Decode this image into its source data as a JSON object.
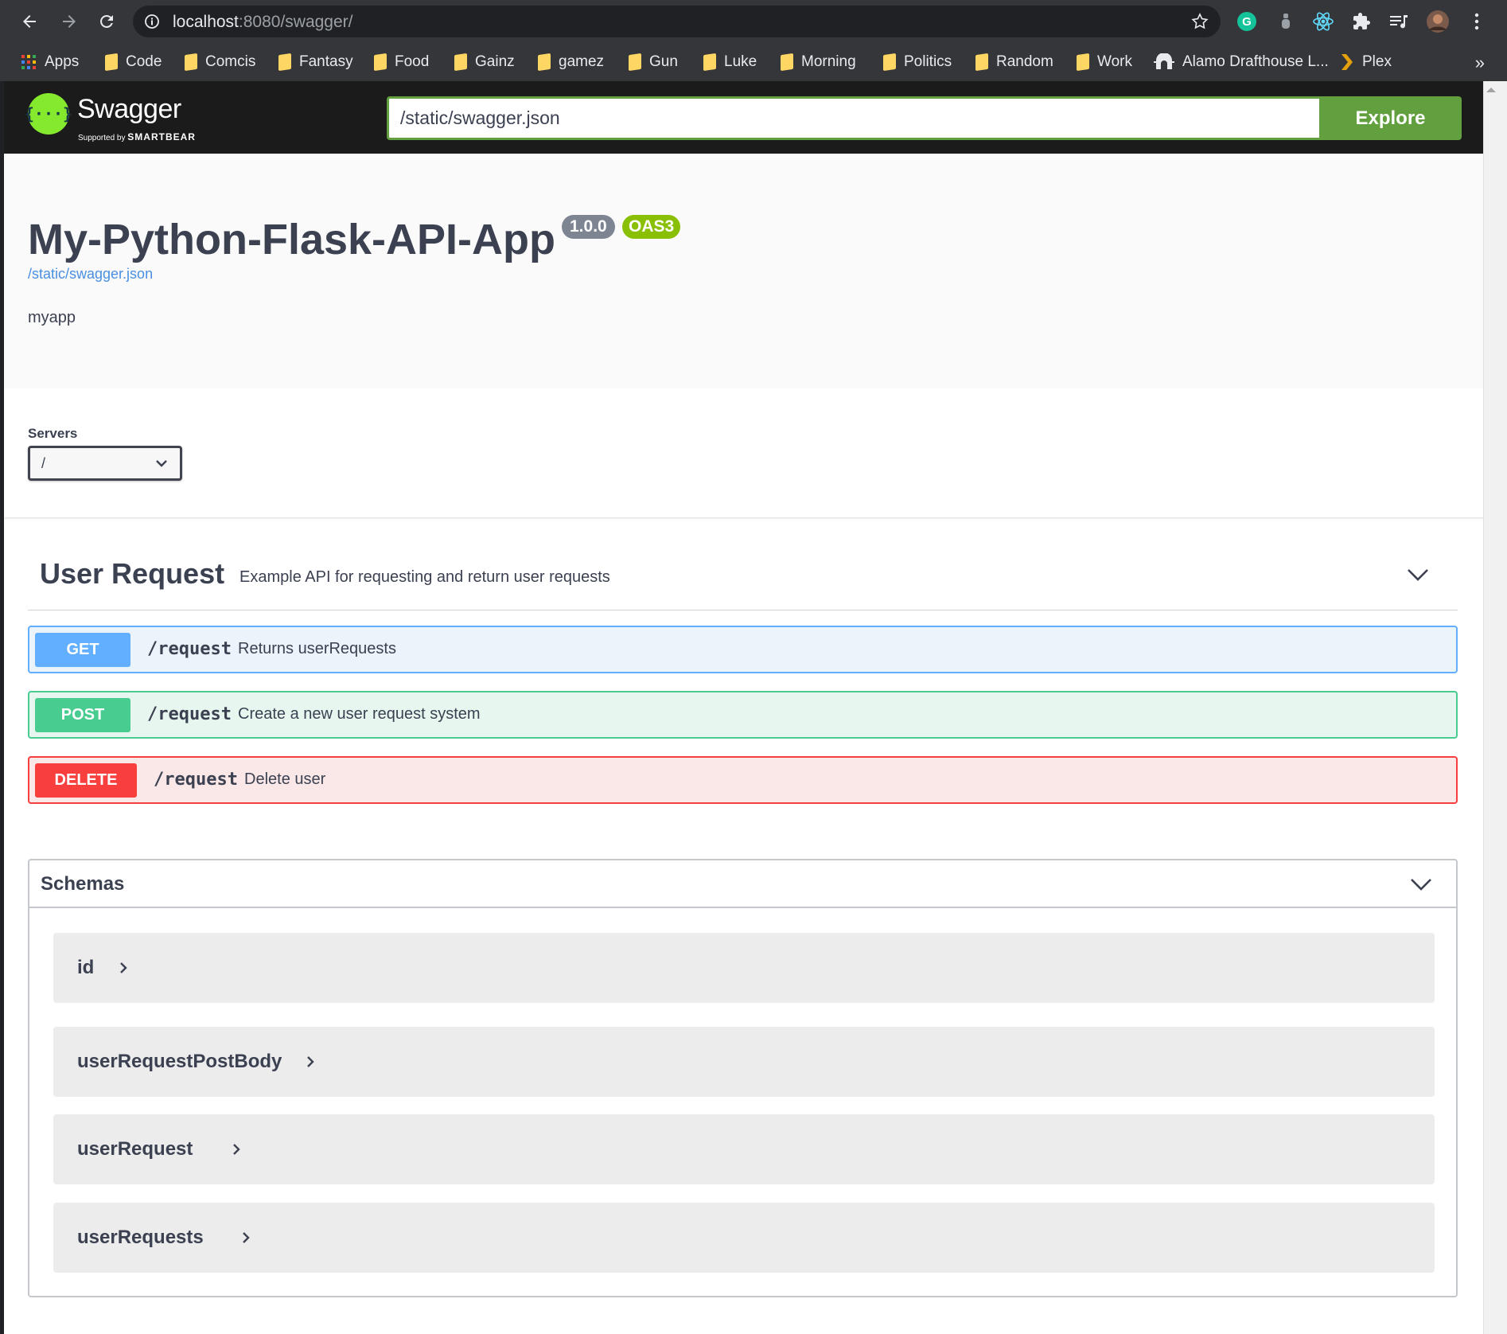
{
  "browser": {
    "url_host": "localhost",
    "url_rest": ":8080/swagger/",
    "bookmarks": [
      {
        "label": "Apps",
        "icon": "apps-grid-icon"
      },
      {
        "label": "Code",
        "icon": "folder-icon"
      },
      {
        "label": "Comcis",
        "icon": "folder-icon"
      },
      {
        "label": "Fantasy",
        "icon": "folder-icon"
      },
      {
        "label": "Food",
        "icon": "folder-icon"
      },
      {
        "label": "Gainz",
        "icon": "folder-icon"
      },
      {
        "label": "gamez",
        "icon": "folder-icon"
      },
      {
        "label": "Gun",
        "icon": "folder-icon"
      },
      {
        "label": "Luke",
        "icon": "folder-icon"
      },
      {
        "label": "Morning",
        "icon": "folder-icon"
      },
      {
        "label": "Politics",
        "icon": "folder-icon"
      },
      {
        "label": "Random",
        "icon": "folder-icon"
      },
      {
        "label": "Work",
        "icon": "folder-icon"
      },
      {
        "label": "Alamo Drafthouse L...",
        "icon": "alamo-icon"
      },
      {
        "label": "Plex",
        "icon": "plex-icon"
      }
    ],
    "more": "»"
  },
  "swagger": {
    "brand": "Swagger",
    "supported_by": "Supported by",
    "smartbear": "SMARTBEAR",
    "spec_url": "/static/swagger.json",
    "explore_label": "Explore"
  },
  "info": {
    "title": "My-Python-Flask-API-App",
    "version": "1.0.0",
    "oas": "OAS3",
    "spec_link": "/static/swagger.json",
    "description": "myapp"
  },
  "servers": {
    "label": "Servers",
    "selected": "/"
  },
  "tag": {
    "name": "User Request",
    "description": "Example API for requesting and return user requests"
  },
  "operations": [
    {
      "method": "GET",
      "path": "/request",
      "summary": "Returns userRequests",
      "color": "#61affe"
    },
    {
      "method": "POST",
      "path": "/request",
      "summary": "Create a new user request system",
      "color": "#49cc90"
    },
    {
      "method": "DELETE",
      "path": "/request",
      "summary": "Delete user",
      "color": "#f93e3e"
    }
  ],
  "schemas": {
    "title": "Schemas",
    "models": [
      "id",
      "userRequestPostBody",
      "userRequest",
      "userRequests"
    ]
  }
}
